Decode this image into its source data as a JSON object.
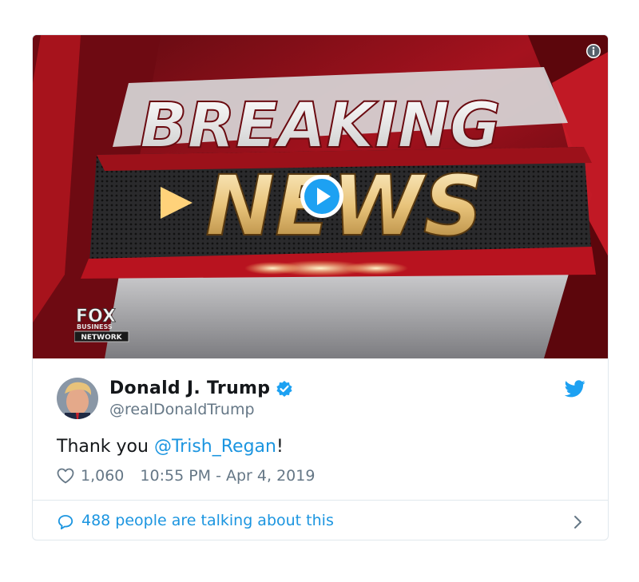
{
  "tweet": {
    "video": {
      "headline_top": "BREAKING",
      "headline_bottom": "NEWS",
      "logo_main": "FOX",
      "logo_sub1": "BUSINESS",
      "logo_sub2": "NETWORK"
    },
    "author": {
      "display_name": "Donald J. Trump",
      "handle": "@realDonaldTrump"
    },
    "text_prefix": "Thank you ",
    "mention": "@Trish_Regan",
    "text_suffix": "!",
    "likes": "1,060",
    "timestamp": "10:55 PM - Apr 4, 2019",
    "talking": "488 people are talking about this"
  },
  "colors": {
    "accent": "#1b95e0",
    "twitter_blue": "#1da1f2",
    "text": "#14171a",
    "muted": "#657786",
    "border": "#e1e8ed"
  },
  "icons": [
    "info-icon",
    "play-icon",
    "verified-icon",
    "twitter-bird-icon",
    "heart-icon",
    "speech-bubble-icon",
    "chevron-right-icon"
  ]
}
